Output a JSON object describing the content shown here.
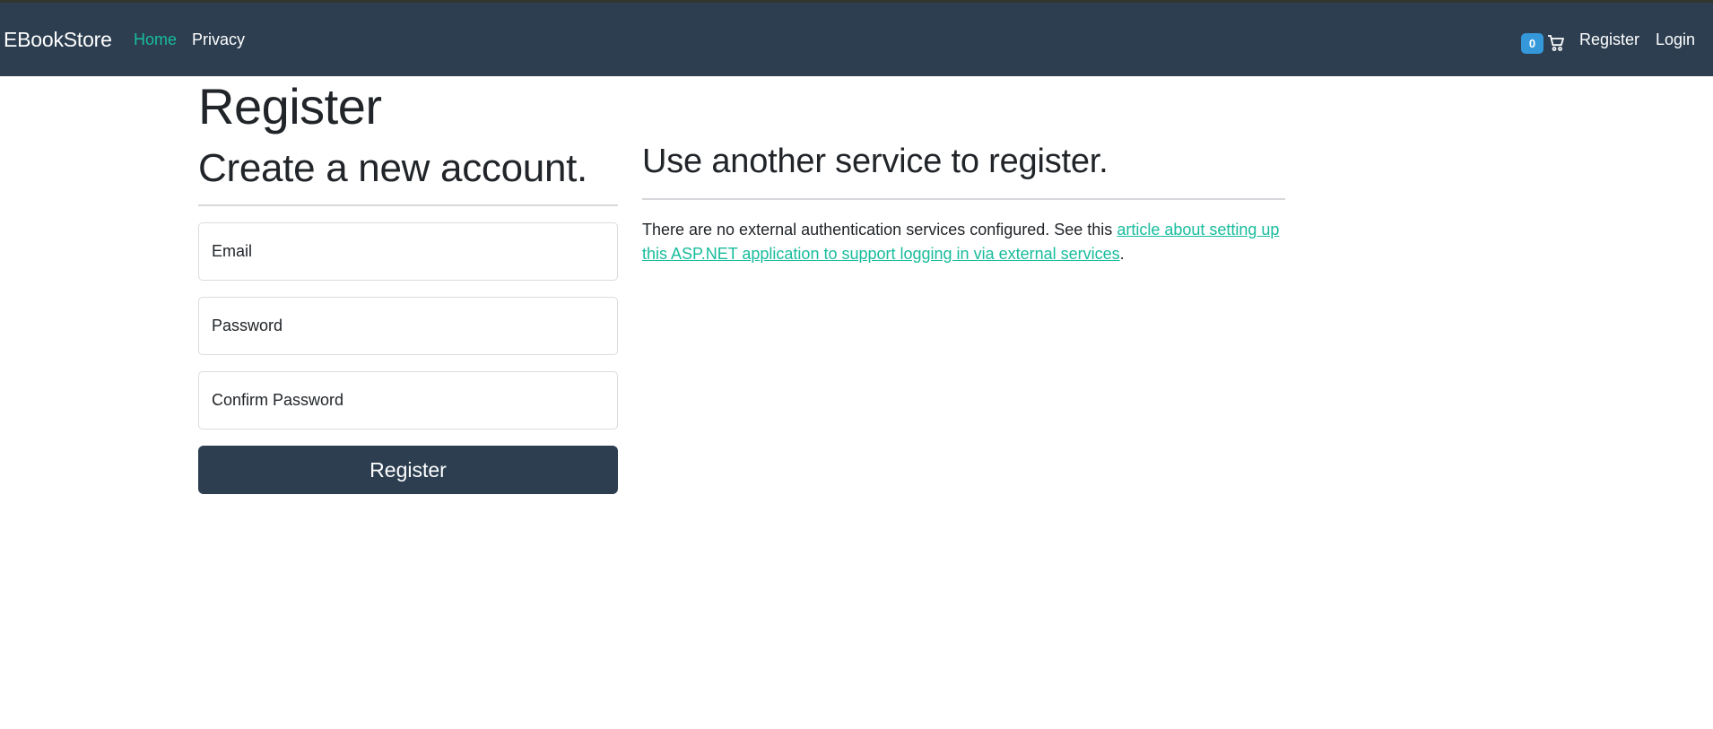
{
  "navbar": {
    "brand": "EBookStore",
    "links": [
      "Home",
      "Privacy"
    ],
    "cart_count": "0",
    "cart_icon": "cart-icon",
    "right_links": [
      "Register",
      "Login"
    ],
    "active_color": "#18bc9c",
    "background_color": "#2c3e50"
  },
  "page": {
    "title": "Register"
  },
  "register_form": {
    "heading": "Create a new account.",
    "email_placeholder": "Email",
    "password_placeholder": "Password",
    "confirm_password_placeholder": "Confirm Password",
    "submit_label": "Register"
  },
  "external": {
    "heading": "Use another service to register.",
    "text_before": "There are no external authentication services configured. See this ",
    "link_text": "article about setting up this ASP.NET application to support logging in via external services",
    "text_after": "."
  }
}
